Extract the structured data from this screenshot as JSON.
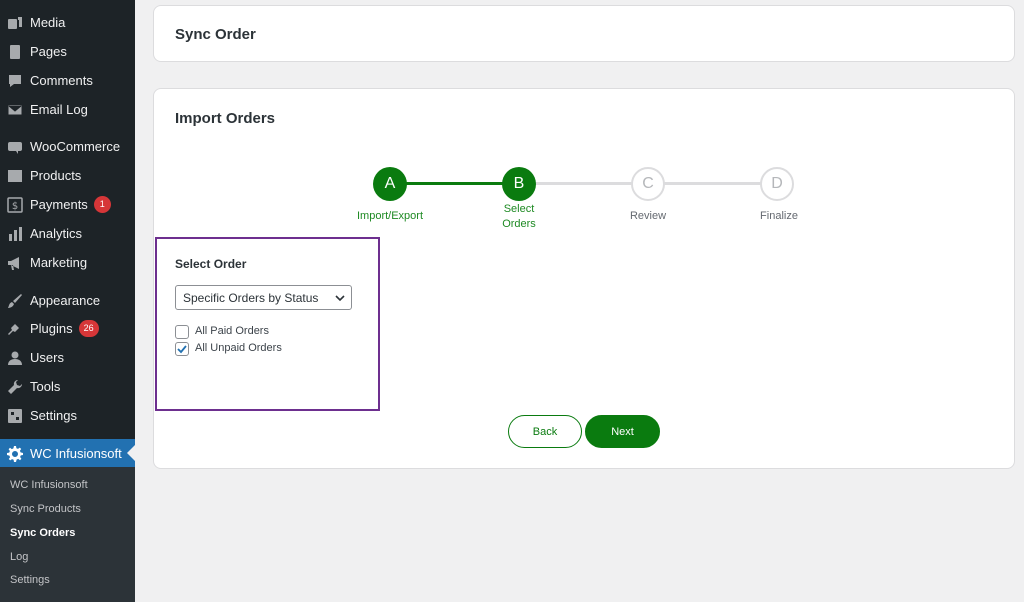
{
  "sidebar": {
    "items": [
      {
        "label": "Media",
        "icon": "media-icon"
      },
      {
        "label": "Pages",
        "icon": "pages-icon"
      },
      {
        "label": "Comments",
        "icon": "comments-icon"
      },
      {
        "label": "Email Log",
        "icon": "email-icon"
      },
      {
        "label": "WooCommerce",
        "icon": "woocommerce-icon"
      },
      {
        "label": "Products",
        "icon": "products-icon"
      },
      {
        "label": "Payments",
        "icon": "payments-icon",
        "badge": "1"
      },
      {
        "label": "Analytics",
        "icon": "analytics-icon"
      },
      {
        "label": "Marketing",
        "icon": "marketing-icon"
      },
      {
        "label": "Appearance",
        "icon": "appearance-icon"
      },
      {
        "label": "Plugins",
        "icon": "plugins-icon",
        "badge": "26"
      },
      {
        "label": "Users",
        "icon": "users-icon"
      },
      {
        "label": "Tools",
        "icon": "tools-icon"
      },
      {
        "label": "Settings",
        "icon": "settings-icon"
      },
      {
        "label": "WC Infusionsoft",
        "icon": "gear-icon",
        "active": true
      }
    ],
    "submenu": [
      {
        "label": "WC Infusionsoft"
      },
      {
        "label": "Sync Products"
      },
      {
        "label": "Sync Orders",
        "current": true
      },
      {
        "label": "Log"
      },
      {
        "label": "Settings"
      }
    ]
  },
  "header": {
    "title": "Sync Order"
  },
  "import": {
    "title": "Import Orders",
    "steps": [
      {
        "letter": "A",
        "label": "Import/Export",
        "state": "done"
      },
      {
        "letter": "B",
        "label_line1": "Select",
        "label_line2": "Orders",
        "state": "done"
      },
      {
        "letter": "C",
        "label": "Review",
        "state": "todo"
      },
      {
        "letter": "D",
        "label": "Finalize",
        "state": "todo"
      }
    ],
    "select_order": {
      "heading": "Select Order",
      "dropdown_value": "Specific Orders by Status",
      "options": [
        {
          "label": "All Paid Orders",
          "checked": false
        },
        {
          "label": "All Unpaid Orders",
          "checked": true
        }
      ]
    },
    "back_label": "Back",
    "next_label": "Next"
  },
  "colors": {
    "accent_green": "#0a7b0f",
    "wp_blue": "#2271b1",
    "frame_purple": "#6d2f8f",
    "sidebar_bg": "#1d2327"
  }
}
